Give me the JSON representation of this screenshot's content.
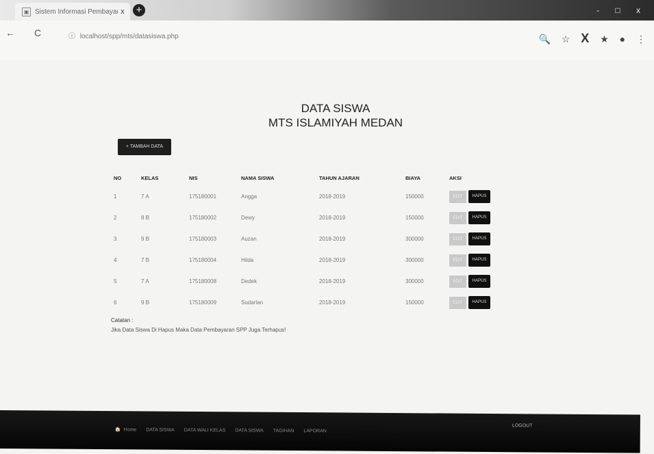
{
  "browser": {
    "tab_title": "Sistem Informasi Pembayaran S",
    "tab_close": "x",
    "new_tab": "+",
    "window_controls": "- □ x",
    "back": "←",
    "forward": "→",
    "reload": "C",
    "url": "localhost/spp/mts/datasiswa.php",
    "url_icon": "ⓘ",
    "right_icons": [
      "🔍",
      "☆",
      "X",
      "★",
      "●",
      "⋮"
    ]
  },
  "page": {
    "title_line1": "DATA SISWA",
    "title_line2": "MTS ISLAMIYAH MEDAN",
    "add_button": "+ TAMBAH DATA"
  },
  "table": {
    "headers": [
      "NO",
      "KELAS",
      "NIS",
      "NAMA SISWA",
      "TAHUN AJARAN",
      "BIAYA",
      "AKSI"
    ],
    "rows": [
      {
        "no": "1",
        "kelas": "7 A",
        "nis": "175180001",
        "nama": "Angga",
        "tahun": "2018-2019",
        "biaya": "150000",
        "edit": "EDIT",
        "hapus": "HAPUS"
      },
      {
        "no": "2",
        "kelas": "8 B",
        "nis": "175180002",
        "nama": "Dewy",
        "tahun": "2018-2019",
        "biaya": "150000",
        "edit": "EDIT",
        "hapus": "HAPUS"
      },
      {
        "no": "3",
        "kelas": "9 B",
        "nis": "175180003",
        "nama": "Auzan",
        "tahun": "2018-2019",
        "biaya": "300000",
        "edit": "EDIT",
        "hapus": "HAPUS"
      },
      {
        "no": "4",
        "kelas": "7 B",
        "nis": "175180004",
        "nama": "Hilda",
        "tahun": "2018-2019",
        "biaya": "300000",
        "edit": "EDIT",
        "hapus": "HAPUS"
      },
      {
        "no": "5",
        "kelas": "7 A",
        "nis": "175180008",
        "nama": "Dedek",
        "tahun": "2018-2019",
        "biaya": "300000",
        "edit": "EDIT",
        "hapus": "HAPUS"
      },
      {
        "no": "6",
        "kelas": "9 B",
        "nis": "175180009",
        "nama": "Sudarlan",
        "tahun": "2018-2019",
        "biaya": "150000",
        "edit": "EDIT",
        "hapus": "HAPUS"
      }
    ]
  },
  "note": {
    "label": "Catatan :",
    "text": "Jika Data Siswa Di Hapus Maka Data Pembayaran SPP Juga Terhapus!"
  },
  "footer": {
    "home_icon": "🏠",
    "menu": [
      "Home",
      "DATA SISWA",
      "DATA WALI KELAS",
      "DATA SISWA",
      "TAGIHAN",
      "LAPORAN"
    ],
    "logout": "LOGOUT"
  }
}
